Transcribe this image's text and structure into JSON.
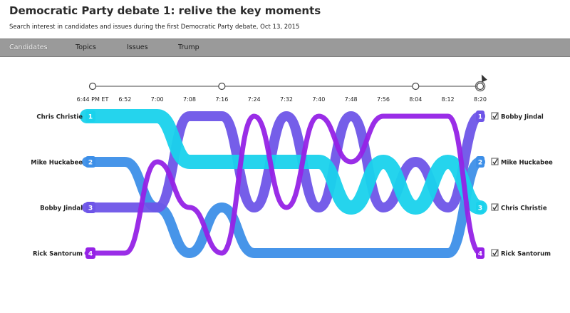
{
  "header": {
    "title": "Democratic Party debate 1: relive the key moments",
    "subtitle": "Search interest in candidates and issues during the first Democratic Party debate, Oct 13, 2015"
  },
  "tabs": [
    {
      "label": "Candidates",
      "active": true
    },
    {
      "label": "Topics",
      "active": false
    },
    {
      "label": "Issues",
      "active": false
    },
    {
      "label": "Trump",
      "active": false
    }
  ],
  "timeline": {
    "ticks": [
      "6:44 PM ET",
      "6:52",
      "7:00",
      "7:08",
      "7:16",
      "7:24",
      "7:32",
      "7:40",
      "7:48",
      "7:56",
      "8:04",
      "8:12",
      "8:20"
    ],
    "markers_at": [
      0,
      4,
      10,
      12
    ],
    "selected": 12
  },
  "chart_data": {
    "type": "line",
    "x": [
      "6:44 PM ET",
      "6:52",
      "7:00",
      "7:08",
      "7:16",
      "7:24",
      "7:32",
      "7:40",
      "7:48",
      "7:56",
      "8:04",
      "8:12",
      "8:20"
    ],
    "ylim": [
      1,
      4
    ],
    "y_inverted": true,
    "series": [
      {
        "name": "Chris Christie",
        "color": "#19d2ec",
        "start_rank": "1",
        "end_rank": "3",
        "values": [
          1,
          1,
          1,
          2,
          2,
          2,
          2,
          2,
          3,
          2,
          3,
          2,
          3
        ]
      },
      {
        "name": "Mike Huckabee",
        "color": "#3d8fe8",
        "start_rank": "2",
        "end_rank": "2",
        "values": [
          2,
          2,
          3,
          4,
          3,
          4,
          4,
          4,
          4,
          4,
          4,
          4,
          2
        ]
      },
      {
        "name": "Bobby Jindal",
        "color": "#6e55e8",
        "start_rank": "3",
        "end_rank": "1",
        "values": [
          3,
          3,
          3,
          1,
          1,
          3,
          1,
          3,
          1,
          3,
          2,
          3,
          1
        ]
      },
      {
        "name": "Rick Santorum",
        "color": "#9522e6",
        "start_rank": "4",
        "end_rank": "4",
        "values": [
          4,
          4,
          2,
          3,
          4,
          1,
          3,
          1,
          2,
          1,
          1,
          1,
          4
        ]
      }
    ]
  }
}
